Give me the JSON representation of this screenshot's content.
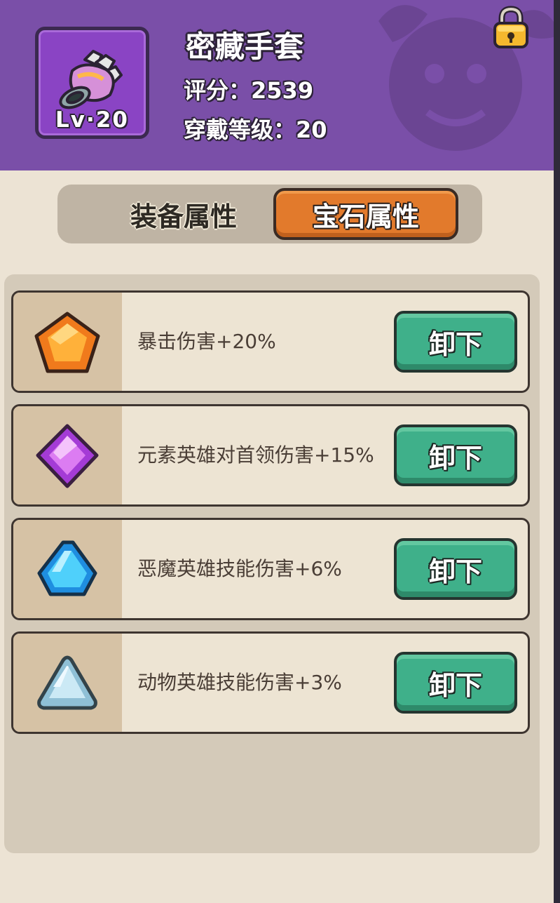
{
  "item": {
    "name": "密藏手套",
    "level_badge": "Lv·20",
    "score_label": "评分：",
    "score_value": "2539",
    "req_label": "穿戴等级：",
    "req_value": "20",
    "icon": "glove-icon",
    "locked": true
  },
  "tabs": [
    {
      "label": "装备属性",
      "active": false
    },
    {
      "label": "宝石属性",
      "active": true
    }
  ],
  "gems": [
    {
      "icon": "orange-pentagon-gem-icon",
      "text": "暴击伤害+20%",
      "button": "卸下"
    },
    {
      "icon": "purple-diamond-gem-icon",
      "text": "元素英雄对首领伤害+15%",
      "button": "卸下"
    },
    {
      "icon": "blue-gem-icon",
      "text": "恶魔英雄技能伤害+6%",
      "button": "卸下"
    },
    {
      "icon": "light-blue-triangle-gem-icon",
      "text": "动物英雄技能伤害+3%",
      "button": "卸下"
    }
  ],
  "colors": {
    "header": "#7a4fa8",
    "panel": "#ece3d4",
    "active_tab": "#e27a2c",
    "unequip_button": "#3fb08a"
  }
}
